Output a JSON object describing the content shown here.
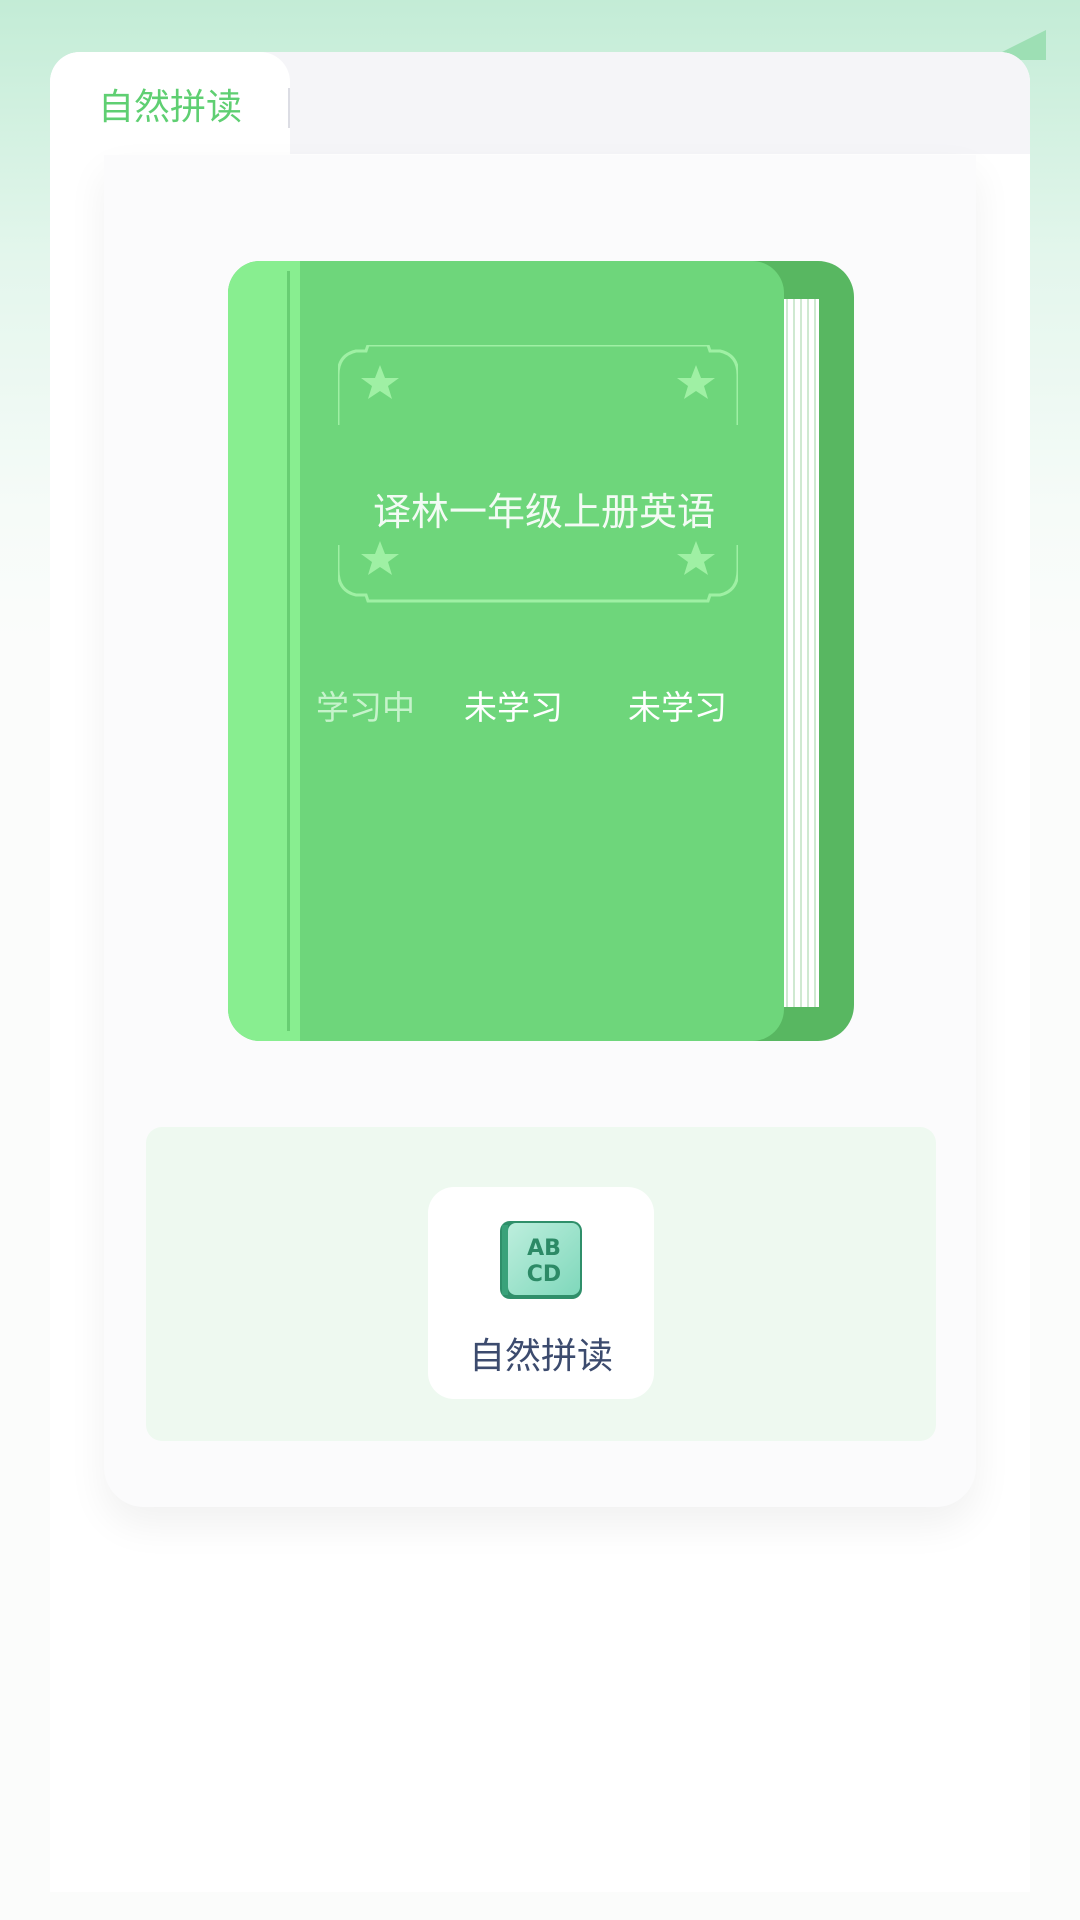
{
  "tabs": [
    {
      "label": "自然拼读",
      "active": true
    }
  ],
  "book": {
    "title": "译林一年级上册英语",
    "statuses": [
      {
        "label": "学习中",
        "state": "learning"
      },
      {
        "label": "未学习",
        "state": "not-started"
      },
      {
        "label": "未学习",
        "state": "not-started"
      }
    ]
  },
  "features": [
    {
      "label": "自然拼读",
      "icon": "abcd-book-icon",
      "icon_text_top": "AB",
      "icon_text_bottom": "CD"
    }
  ],
  "colors": {
    "accent": "#5fcf72",
    "book_cover": "#6ed67b",
    "book_back": "#58b761",
    "feature_bg": "#eef9f0",
    "label_text": "#3c4b6e"
  }
}
